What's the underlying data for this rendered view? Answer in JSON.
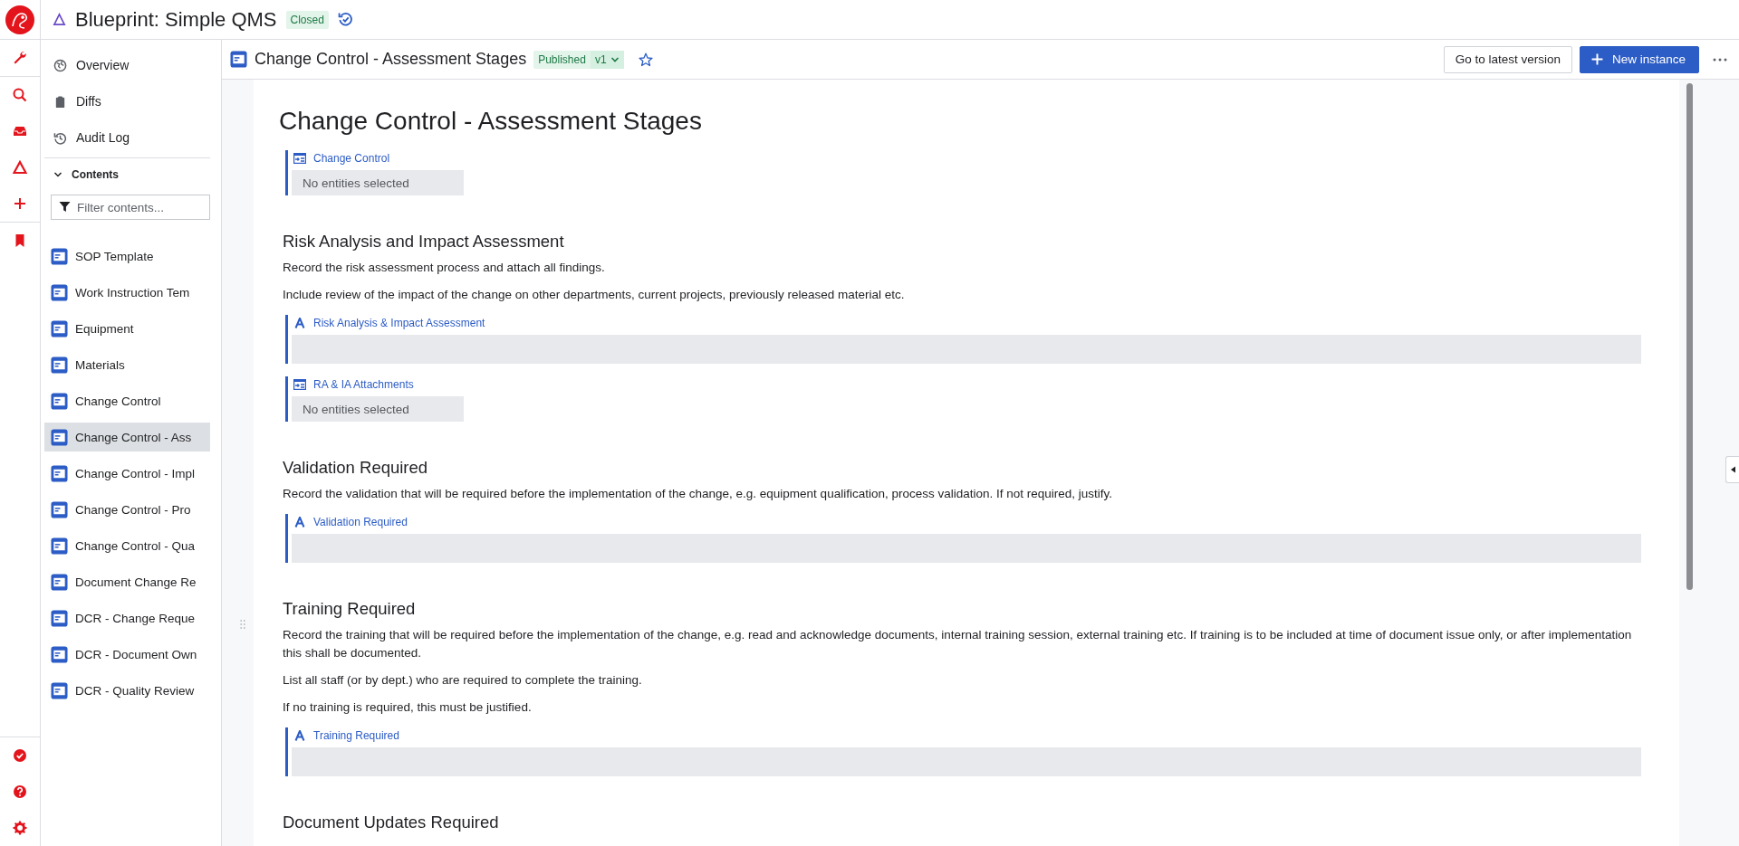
{
  "app": {
    "title": "Blueprint: Simple QMS",
    "status": "Closed"
  },
  "nav": [
    {
      "label": "Overview",
      "kind": "globe"
    },
    {
      "label": "Diffs",
      "kind": "clipboard"
    },
    {
      "label": "Audit Log",
      "kind": "history"
    }
  ],
  "contents": {
    "label": "Contents",
    "expanded": true,
    "filter_placeholder": "Filter contents...",
    "items": [
      {
        "label": "SOP Template",
        "selected": false
      },
      {
        "label": "Work Instruction Tem",
        "selected": false
      },
      {
        "label": "Equipment",
        "selected": false
      },
      {
        "label": "Materials",
        "selected": false
      },
      {
        "label": "Change Control",
        "selected": false
      },
      {
        "label": "Change Control - Ass",
        "selected": true
      },
      {
        "label": "Change Control - Impl",
        "selected": false
      },
      {
        "label": "Change Control - Pro",
        "selected": false
      },
      {
        "label": "Change Control - Qua",
        "selected": false
      },
      {
        "label": "Document Change Re",
        "selected": false
      },
      {
        "label": "DCR - Change Reque",
        "selected": false
      },
      {
        "label": "DCR - Document Own",
        "selected": false
      },
      {
        "label": "DCR - Quality Review",
        "selected": false
      }
    ]
  },
  "document": {
    "title": "Change Control - Assessment Stages",
    "status": "Published",
    "version": "v1",
    "starred": false,
    "actions": [
      "Go to latest version",
      "New instance"
    ]
  },
  "body": {
    "title": "Change Control - Assessment Stages",
    "blocks": [
      {
        "kind": "entity_field",
        "label": "Change Control",
        "value": "No entities selected"
      },
      {
        "kind": "heading",
        "text": "Risk Analysis and Impact Assessment"
      },
      {
        "kind": "paragraph",
        "text": "Record the risk assessment process and attach all findings."
      },
      {
        "kind": "paragraph",
        "text": "Include review of the impact of the change on other departments, current projects, previously released material etc."
      },
      {
        "kind": "text_field",
        "label": "Risk Analysis & Impact Assessment"
      },
      {
        "kind": "entity_field",
        "label": "RA & IA Attachments",
        "value": "No entities selected"
      },
      {
        "kind": "heading",
        "text": "Validation Required"
      },
      {
        "kind": "paragraph",
        "text": "Record the validation that will be required before the implementation of the change, e.g. equipment qualification, process validation.  If not required, justify."
      },
      {
        "kind": "text_field",
        "label": "Validation Required"
      },
      {
        "kind": "heading",
        "text": "Training Required"
      },
      {
        "kind": "paragraph",
        "text": "Record the training that will be required before the implementation of the change, e.g. read and acknowledge documents, internal training session, external training etc.  If training is to be included at time of document issue only, or after implementation this shall be documented."
      },
      {
        "kind": "paragraph",
        "text": "List all staff (or by dept.) who are required to complete the training."
      },
      {
        "kind": "paragraph",
        "text": "If no training is required, this must be justified."
      },
      {
        "kind": "text_field",
        "label": "Training Required"
      },
      {
        "kind": "heading",
        "text": "Document Updates Required"
      }
    ]
  }
}
